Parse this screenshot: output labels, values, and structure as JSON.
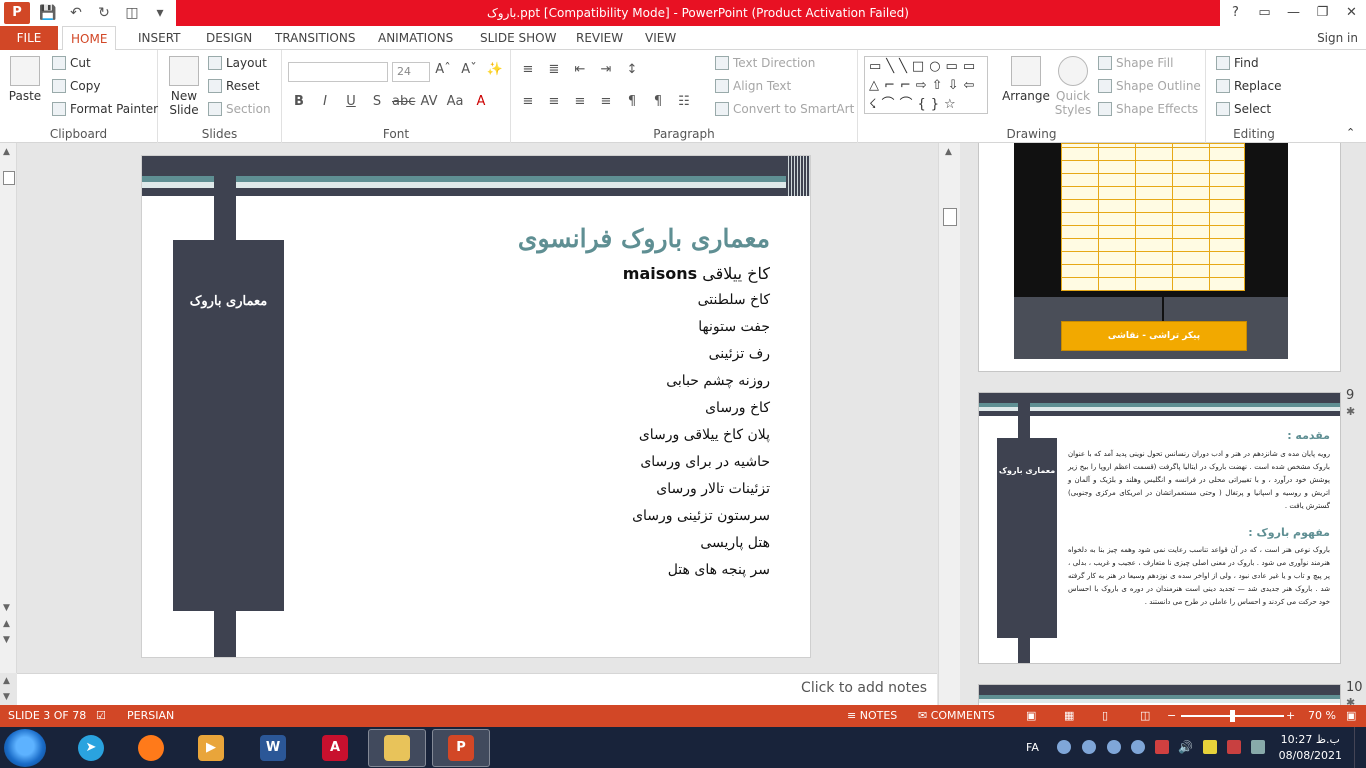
{
  "titlebar": {
    "title": "باروک.ppt [Compatibility Mode] - PowerPoint (Product Activation Failed)",
    "help": "?"
  },
  "tabs": {
    "file": "FILE",
    "items": [
      "HOME",
      "INSERT",
      "DESIGN",
      "TRANSITIONS",
      "ANIMATIONS",
      "SLIDE SHOW",
      "REVIEW",
      "VIEW"
    ],
    "signin": "Sign in"
  },
  "ribbon": {
    "clipboard": {
      "label": "Clipboard",
      "paste": "Paste",
      "cut": "Cut",
      "copy": "Copy",
      "format_painter": "Format Painter"
    },
    "slides": {
      "label": "Slides",
      "new_slide": "New Slide",
      "layout": "Layout",
      "reset": "Reset",
      "section": "Section"
    },
    "font": {
      "label": "Font",
      "font_name": "",
      "font_size": "24"
    },
    "paragraph": {
      "label": "Paragraph",
      "text_direction": "Text Direction",
      "align_text": "Align Text",
      "convert_smartart": "Convert to SmartArt"
    },
    "drawing": {
      "label": "Drawing",
      "arrange": "Arrange",
      "quick_styles": "Quick Styles",
      "shape_fill": "Shape Fill",
      "shape_outline": "Shape Outline",
      "shape_effects": "Shape Effects"
    },
    "editing": {
      "label": "Editing",
      "find": "Find",
      "replace": "Replace",
      "select": "Select"
    }
  },
  "slide": {
    "side_panel_text": "معماری باروک",
    "title": "معماری باروک فرانسوی",
    "first_item_persian": "کاخ ییلاقی",
    "first_item_latin": "maisons",
    "items": [
      "کاخ سلطنتی",
      "جفت ستونها",
      "رف تزئینی",
      "روزنه چشم حبابی",
      "کاخ ورسای",
      "پلان کاخ ییلاقی ورسای",
      "حاشیه در برای ورسای",
      "تزئینات تالار ورسای",
      "سرستون تزئینی ورسای",
      "هتل پاریسی",
      "سر پنجه های هتل"
    ]
  },
  "notes": {
    "placeholder": "Click to add notes"
  },
  "thumbnails": {
    "slide8_box_text": "پیکر تراشی - نقاشی",
    "slide9": {
      "number": "9",
      "panel_text": "معماری باروک",
      "heading1": "مقدمه :",
      "para1": "رویه پایان مده ی شانزدهم در هنر و ادب دوران رنسانس تحول نوینی پدید آمد که با عنوان باروک مشخص شده است . نهضت باروک در ایتالیا پاگرفت (قسمت اعظم اروپا را بیخ زیر پوشش خود درآورد ، و با تغییراتی محلی در فرانسه و انگلیس وهلند و بلژیک و آلمان و اتریش و روسیه و اسپانیا و پرتغال ( وحتی مستعمراتشان در امریکای مرکزی وجنوبی) گسترش یافت .",
      "heading2": "مفهوم باروک :",
      "para2": "باروک نوعی هنر است ، که در آن قواعد تناسب رعایت نمی شود وهمه چیز بنا به دلخواه هنرمند نوآوری می شود . باروک در معنی اصلی چیزی نا متعارف ، عجیب و غریب ، بدلی ، پر پیچ و تاب و یا غیر عادی نبود ، ولی از اواخر سده ی نوزدهم وسیعا در هنر به کار گرفته شد . باروک هنر جدیدی شد — تجدید دینی است هنرمندان در دوره ی باروک با احساس خود حرکت می کردند و احساس را عاملی در طرح می دانستند ."
    },
    "slide10": {
      "number": "10"
    }
  },
  "statusbar": {
    "slide_counter": "SLIDE 3 OF 78",
    "language": "PERSIAN",
    "notes": "NOTES",
    "comments": "COMMENTS",
    "zoom": "70 %",
    "zoom_level": 0.5
  },
  "taskbar": {
    "language": "FA",
    "clock_day": "ب.ظ",
    "clock_time": "10:27",
    "clock_date": "08/08/2021"
  },
  "colors": {
    "accent": "#d24726",
    "slide_dark": "#3e4250",
    "slide_teal": "#5f8f93",
    "alert_red": "#e81123"
  }
}
